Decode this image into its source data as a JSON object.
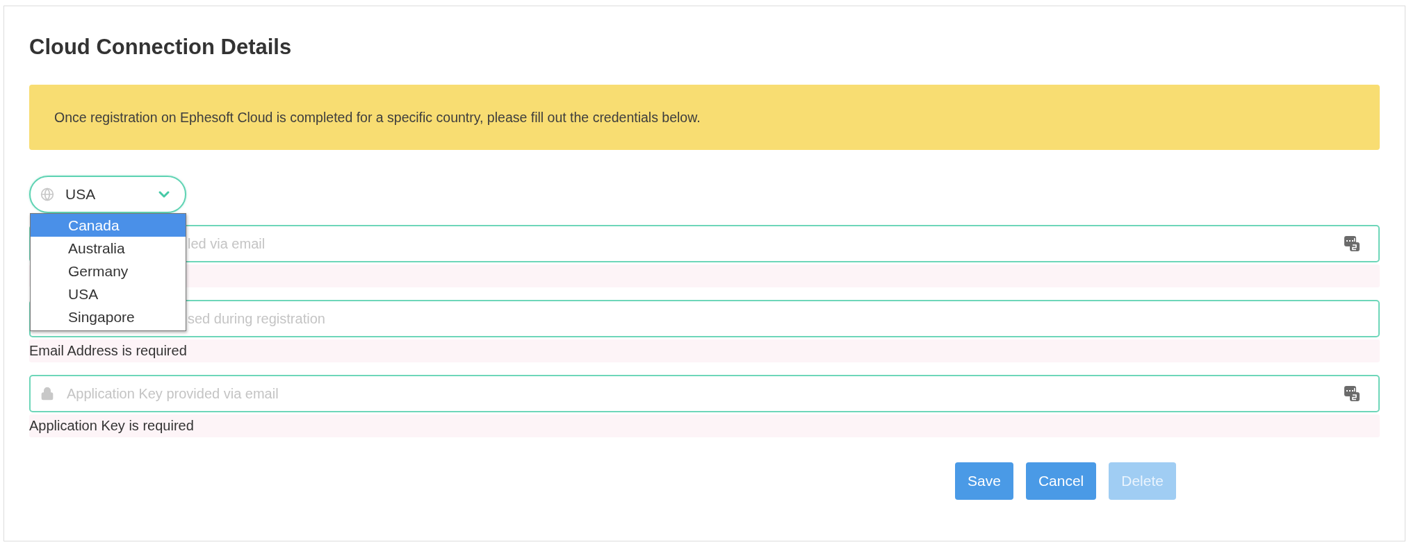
{
  "title": "Cloud Connection Details",
  "notice": "Once registration on Ephesoft Cloud is completed for a specific country, please fill out the credentials below.",
  "country_select": {
    "value": "USA",
    "open": true,
    "options": [
      {
        "label": "Canada",
        "highlighted": true
      },
      {
        "label": "Australia",
        "highlighted": false
      },
      {
        "label": "Germany",
        "highlighted": false
      },
      {
        "label": "USA",
        "highlighted": false
      },
      {
        "label": "Singapore",
        "highlighted": false
      }
    ]
  },
  "fields": [
    {
      "placeholder": "led via email",
      "keypad_icon": true
    },
    {
      "placeholder": "sed during registration",
      "keypad_icon": false,
      "error": "Email Address is required"
    },
    {
      "placeholder": "Application Key provided via email",
      "keypad_icon": true,
      "error": "Application Key is required"
    }
  ],
  "buttons": [
    {
      "label": "Save",
      "disabled": false
    },
    {
      "label": "Cancel",
      "disabled": false
    },
    {
      "label": "Delete",
      "disabled": true
    }
  ]
}
